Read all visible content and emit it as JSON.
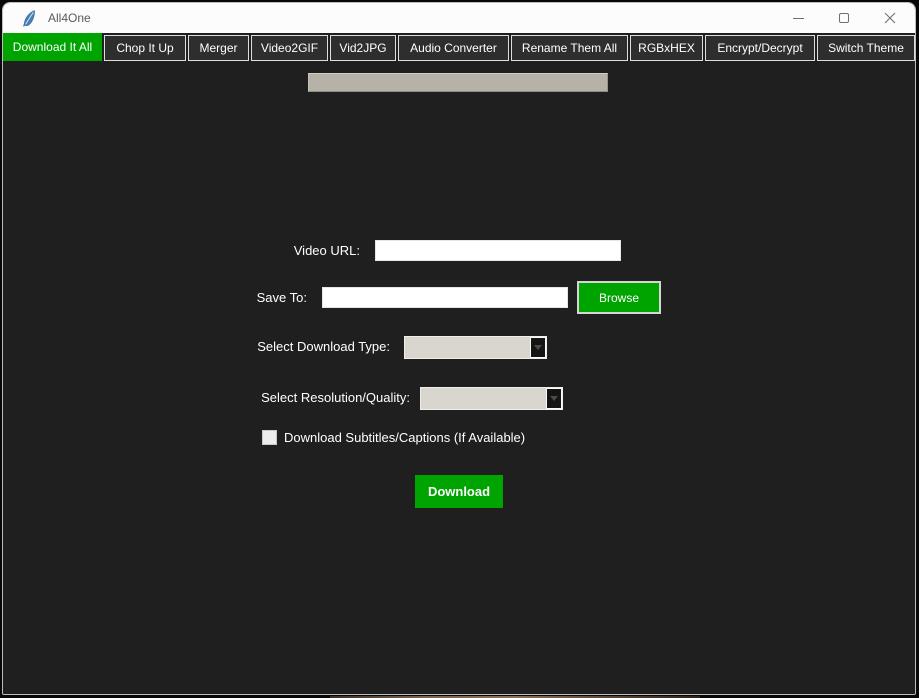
{
  "window": {
    "title": "All4One"
  },
  "tabs": [
    {
      "label": "Download It All",
      "selected": true
    },
    {
      "label": "Chop It Up",
      "selected": false
    },
    {
      "label": "Merger",
      "selected": false
    },
    {
      "label": "Video2GIF",
      "selected": false
    },
    {
      "label": "Vid2JPG",
      "selected": false
    },
    {
      "label": "Audio Converter",
      "selected": false
    },
    {
      "label": "Rename Them All",
      "selected": false
    },
    {
      "label": "RGBxHEX",
      "selected": false
    },
    {
      "label": "Encrypt/Decrypt",
      "selected": false
    },
    {
      "label": "Switch Theme",
      "selected": false
    }
  ],
  "progress": {
    "value_percent": 0
  },
  "form": {
    "video_url": {
      "label": "Video URL:",
      "value": ""
    },
    "save_to": {
      "label": "Save To:",
      "value": "",
      "browse_button": "Browse"
    },
    "download_type": {
      "label": "Select Download Type:",
      "selected_value": ""
    },
    "resolution": {
      "label": "Select Resolution/Quality:",
      "selected_value": ""
    },
    "subtitles_checkbox": {
      "label": "Download Subtitles/Captions (If Available)",
      "checked": false
    },
    "download_button": "Download"
  },
  "colors": {
    "accent_green": "#00a400",
    "content_bg": "#1f1f1f",
    "tab_bg": "#2e2e2e",
    "titlebar_bg": "#fcfcfc",
    "progress_trough": "#b6b2a8",
    "combobox_field": "#d9d6cf"
  }
}
